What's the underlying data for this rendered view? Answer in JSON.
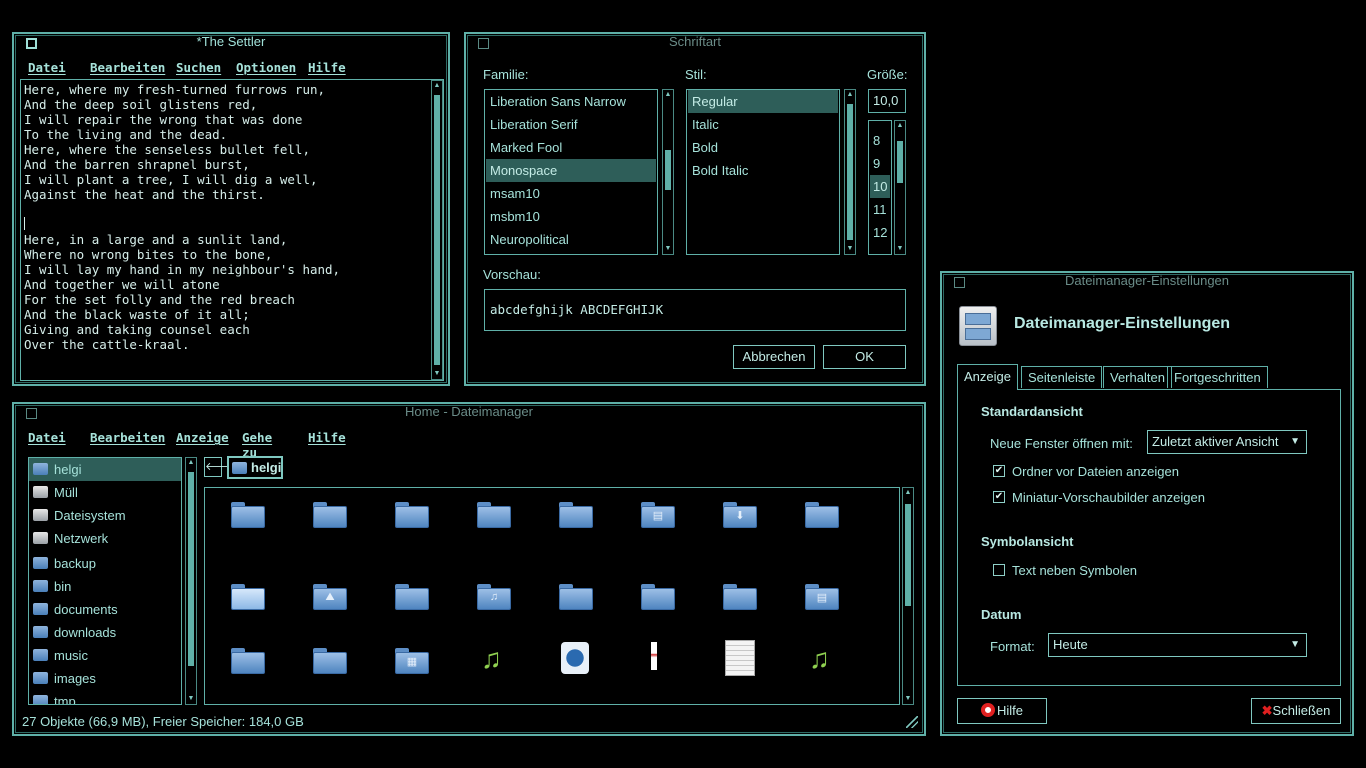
{
  "editor": {
    "title": "*The Settler",
    "menu": [
      "Datei",
      "Bearbeiten",
      "Suchen",
      "Optionen",
      "Hilfe"
    ],
    "lines": [
      "Here, where my fresh-turned furrows run,",
      "And the deep soil glistens red,",
      "I will repair the wrong that was done",
      "To the living and the dead.",
      "Here, where the senseless bullet fell,",
      "And the barren shrapnel burst,",
      "I will plant a tree, I will dig a well,",
      "Against the heat and the thirst.",
      "",
      "",
      "Here, in a large and a sunlit land,",
      "Where no wrong bites to the bone,",
      "I will lay my hand in my neighbour's hand,",
      "And together we will atone",
      "For the set folly and the red breach",
      "And the black waste of it all;",
      "Giving and taking counsel each",
      "Over the cattle-kraal."
    ]
  },
  "font_dialog": {
    "title": "Schriftart",
    "family_label": "Familie:",
    "style_label": "Stil:",
    "size_label": "Größe:",
    "families": [
      "Liberation Sans Narrow",
      "Liberation Serif",
      "Marked Fool",
      "Monospace",
      "msam10",
      "msbm10",
      "Neuropolitical"
    ],
    "selected_family": "Monospace",
    "styles": [
      "Regular",
      "Italic",
      "Bold",
      "Bold Italic"
    ],
    "selected_style": "Regular",
    "size_value": "10,0",
    "sizes": [
      "8",
      "9",
      "10",
      "11",
      "12"
    ],
    "selected_size": "10",
    "preview_label": "Vorschau:",
    "preview_text": "abcdefghijk ABCDEFGHIJK",
    "cancel": "Abbrechen",
    "ok": "OK"
  },
  "file_manager": {
    "title": "Home - Dateimanager",
    "menu": [
      "Datei",
      "Bearbeiten",
      "Anzeige",
      "Gehe zu",
      "Hilfe"
    ],
    "sidebar": [
      "helgi",
      "Müll",
      "Dateisystem",
      "Netzwerk",
      "backup",
      "bin",
      "documents",
      "downloads",
      "music",
      "images",
      "tmp"
    ],
    "selected": "helgi",
    "path_button": "helgi",
    "status": "27 Objekte (66,9 MB), Freier Speicher: 184,0 GB"
  },
  "settings": {
    "title": "Dateimanager-Einstellungen",
    "heading": "Dateimanager-Einstellungen",
    "tabs": [
      "Anzeige",
      "Seitenleiste",
      "Verhalten",
      "Fortgeschritten"
    ],
    "section_default": "Standardansicht",
    "new_window_label": "Neue Fenster öffnen mit:",
    "new_window_value": "Zuletzt aktiver Ansicht",
    "folders_first": "Ordner vor Dateien anzeigen",
    "thumbnails": "Miniatur-Vorschaubilder anzeigen",
    "section_icon": "Symbolansicht",
    "text_beside": "Text neben Symbolen",
    "section_date": "Datum",
    "format_label": "Format:",
    "format_value": "Heute",
    "help": "Hilfe",
    "close": "Schließen"
  },
  "colors": {
    "accent": "#5fb0a8",
    "selection": "#2e5e59",
    "background": "#000000"
  }
}
